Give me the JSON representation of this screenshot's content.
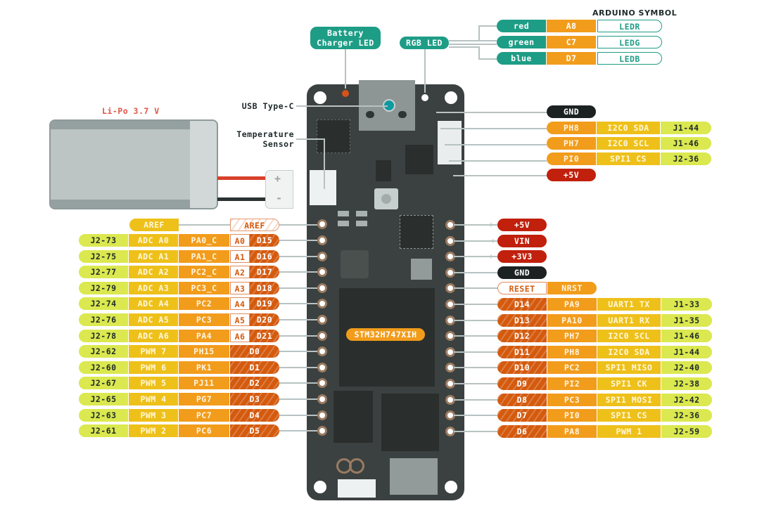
{
  "title_header": "ARDUINO SYMBOL",
  "battery": {
    "label": "Li-Po 3.7 V",
    "plus": "+",
    "minus": "-"
  },
  "callouts": {
    "battery_led": "Battery\nCharger LED",
    "rgb_led": "RGB LED",
    "usb": "USB Type-C",
    "temp": "Temperature\nSensor"
  },
  "mcu_label": "STM32H747XIH",
  "rgb": [
    {
      "color": "red",
      "pin": "A8",
      "symbol": "LEDR"
    },
    {
      "color": "green",
      "pin": "C7",
      "symbol": "LEDG"
    },
    {
      "color": "blue",
      "pin": "D7",
      "symbol": "LEDB"
    }
  ],
  "top_right": {
    "gnd": "GND",
    "rows": [
      {
        "port": "PH8",
        "func": "I2C0 SDA",
        "header": "J1-44"
      },
      {
        "port": "PH7",
        "func": "I2C0 SCL",
        "header": "J1-46"
      },
      {
        "port": "PI0",
        "func": "SPI1 CS",
        "header": "J2-36"
      }
    ],
    "v5": "+5V"
  },
  "left": {
    "aref": {
      "func": "AREF",
      "pin": "AREF"
    },
    "rows": [
      {
        "header": "J2-73",
        "func": "ADC A0",
        "port": "PA0_C",
        "analog": "A0",
        "digital": "D15"
      },
      {
        "header": "J2-75",
        "func": "ADC A1",
        "port": "PA1_C",
        "analog": "A1",
        "digital": "D16"
      },
      {
        "header": "J2-77",
        "func": "ADC A2",
        "port": "PC2_C",
        "analog": "A2",
        "digital": "D17"
      },
      {
        "header": "J2-79",
        "func": "ADC A3",
        "port": "PC3_C",
        "analog": "A3",
        "digital": "D18"
      },
      {
        "header": "J2-74",
        "func": "ADC A4",
        "port": "PC2",
        "analog": "A4",
        "digital": "D19"
      },
      {
        "header": "J2-76",
        "func": "ADC A5",
        "port": "PC3",
        "analog": "A5",
        "digital": "D20"
      },
      {
        "header": "J2-78",
        "func": "ADC A6",
        "port": "PA4",
        "analog": "A6",
        "digital": "D21"
      },
      {
        "header": "J2-62",
        "func": "PWM 7",
        "port": "PH15",
        "analog": "",
        "digital": "D0"
      },
      {
        "header": "J2-60",
        "func": "PWM 6",
        "port": "PK1",
        "analog": "",
        "digital": "D1"
      },
      {
        "header": "J2-67",
        "func": "PWM 5",
        "port": "PJ11",
        "analog": "",
        "digital": "D2"
      },
      {
        "header": "J2-65",
        "func": "PWM 4",
        "port": "PG7",
        "analog": "",
        "digital": "D3"
      },
      {
        "header": "J2-63",
        "func": "PWM 3",
        "port": "PC7",
        "analog": "",
        "digital": "D4"
      },
      {
        "header": "J2-61",
        "func": "PWM 2",
        "port": "PC6",
        "analog": "",
        "digital": "D5"
      }
    ]
  },
  "right": {
    "power": [
      {
        "label": "+5V",
        "kind": "red",
        "dir": "out"
      },
      {
        "label": "VIN",
        "kind": "red",
        "dir": "in"
      },
      {
        "label": "+3V3",
        "kind": "red",
        "dir": "out"
      },
      {
        "label": "GND",
        "kind": "black",
        "dir": ""
      }
    ],
    "reset": {
      "label": "RESET",
      "port": "NRST"
    },
    "rows": [
      {
        "digital": "D14",
        "port": "PA9",
        "func": "UART1 TX",
        "header": "J1-33"
      },
      {
        "digital": "D13",
        "port": "PA10",
        "func": "UART1 RX",
        "header": "J1-35"
      },
      {
        "digital": "D12",
        "port": "PH7",
        "func": "I2C0 SCL",
        "header": "J1-46"
      },
      {
        "digital": "D11",
        "port": "PH8",
        "func": "I2C0 SDA",
        "header": "J1-44"
      },
      {
        "digital": "D10",
        "port": "PC2",
        "func": "SPI1 MISO",
        "header": "J2-40"
      },
      {
        "digital": "D9",
        "port": "PI2",
        "func": "SPI1 CK",
        "header": "J2-38"
      },
      {
        "digital": "D8",
        "port": "PC3",
        "func": "SPI1 MOSI",
        "header": "J2-42"
      },
      {
        "digital": "D7",
        "port": "PI0",
        "func": "SPI1 CS",
        "header": "J2-36"
      },
      {
        "digital": "D6",
        "port": "PA8",
        "func": "PWM 1",
        "header": "J2-59"
      }
    ]
  },
  "colors": {
    "header": "#dbe84f",
    "func": "#eec01a",
    "port": "#f29c1c",
    "digital": "#d45a0e",
    "power": "#c0200c",
    "ground": "#1c2222",
    "led": "#1e9d86",
    "board": "#3b4140"
  }
}
